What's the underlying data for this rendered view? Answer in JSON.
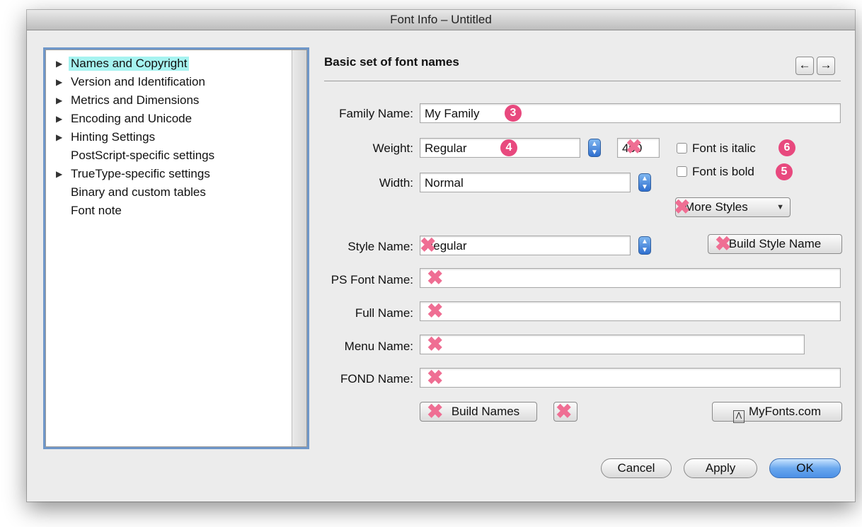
{
  "window": {
    "title": "Font Info – Untitled"
  },
  "sidebar": {
    "items": [
      {
        "label": "Names and Copyright",
        "expandable": true,
        "selected": true
      },
      {
        "label": "Version and Identification",
        "expandable": true
      },
      {
        "label": "Metrics and Dimensions",
        "expandable": true
      },
      {
        "label": "Encoding and Unicode",
        "expandable": true
      },
      {
        "label": "Hinting Settings",
        "expandable": true
      },
      {
        "label": "PostScript-specific settings",
        "expandable": false
      },
      {
        "label": "TrueType-specific settings",
        "expandable": true
      },
      {
        "label": "Binary and custom tables",
        "expandable": false
      },
      {
        "label": "Font note",
        "expandable": false
      }
    ]
  },
  "panel": {
    "title": "Basic set of font names",
    "prev_glyph": "←",
    "next_glyph": "→"
  },
  "form": {
    "family_label": "Family Name:",
    "family_value": "My Family",
    "weight_label": "Weight:",
    "weight_value": "Regular",
    "weight_number": "400",
    "width_label": "Width:",
    "width_value": "Normal",
    "italic_label": "Font is italic",
    "bold_label": "Font is bold",
    "more_styles": "More Styles",
    "style_label": "Style Name:",
    "style_value": "Regular",
    "build_style": "Build Style Name",
    "ps_label": "PS Font Name:",
    "full_label": "Full Name:",
    "menu_label": "Menu Name:",
    "fond_label": "FOND Name:",
    "build_names": "Build Names",
    "myfonts": "MyFonts.com"
  },
  "badges": {
    "three": "3",
    "four": "4",
    "five": "5",
    "six": "6"
  },
  "markers": {
    "x": "✖"
  },
  "footer": {
    "cancel": "Cancel",
    "apply": "Apply",
    "ok": "OK"
  },
  "colors": {
    "selection": "#a6f3f0",
    "badge": "#e8497e",
    "default_button": "#4b8fe6"
  }
}
